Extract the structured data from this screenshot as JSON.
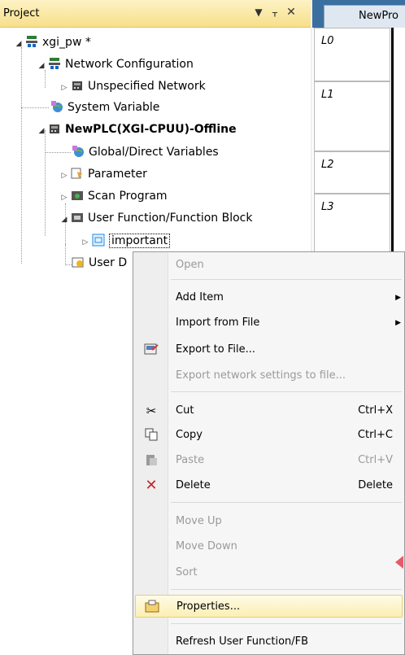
{
  "panel": {
    "title": "Project",
    "dropdown_icon": "chevron-down-icon",
    "pin_icon": "pin-icon",
    "close_icon": "close-icon"
  },
  "tree": {
    "root": "xgi_pw *",
    "network_config": "Network Configuration",
    "unspecified_network": "Unspecified Network",
    "system_variable": "System Variable",
    "plc": "NewPLC(XGI-CPUU)-Offline",
    "global_vars": "Global/Direct Variables",
    "parameter": "Parameter",
    "scan_program": "Scan Program",
    "user_fb": "User Function/Function Block",
    "important": "important",
    "user_d": "User D"
  },
  "editor": {
    "tab": "NewPro",
    "rows": [
      "L0",
      "L1",
      "L2",
      "L3"
    ]
  },
  "menu": {
    "open": "Open",
    "add_item": "Add Item",
    "import_file": "Import from File",
    "export_file": "Export to File...",
    "export_network": "Export network settings to file...",
    "cut": "Cut",
    "cut_sc": "Ctrl+X",
    "copy": "Copy",
    "copy_sc": "Ctrl+C",
    "paste": "Paste",
    "paste_sc": "Ctrl+V",
    "delete": "Delete",
    "delete_sc": "Delete",
    "move_up": "Move Up",
    "move_down": "Move Down",
    "sort": "Sort",
    "properties": "Properties...",
    "refresh": "Refresh User Function/FB"
  },
  "colors": {
    "header_bg": "#f7df8a",
    "highlight": "#fbefb4",
    "disabled_text": "#9a9a9a",
    "delete_icon": "#c0282a",
    "editor_tabbar": "#3b6fa0"
  }
}
